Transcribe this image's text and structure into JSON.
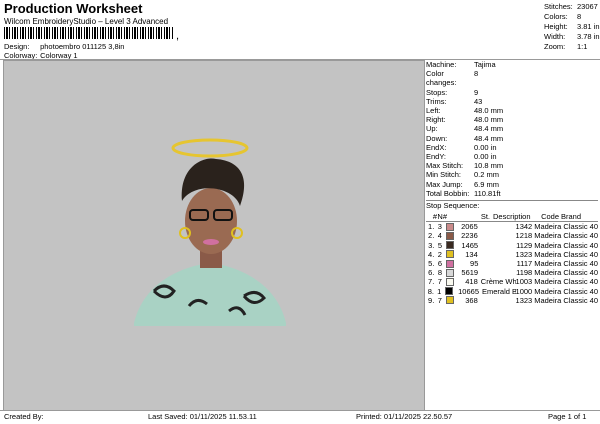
{
  "header": {
    "title": "Production Worksheet",
    "subtitle": "Wilcom EmbroideryStudio – Level 3 Advanced",
    "barcode_sep": ","
  },
  "meta": {
    "design_label": "Design:",
    "design_value": "photoembro 011125 3,8in",
    "colorway_label": "Colorway:",
    "colorway_value": "Colorway 1"
  },
  "summary": [
    {
      "label": "Stitches:",
      "value": "23067"
    },
    {
      "label": "Colors:",
      "value": "8"
    },
    {
      "label": "Height:",
      "value": "3.81 in"
    },
    {
      "label": "Width:",
      "value": "3.78 in"
    },
    {
      "label": "Zoom:",
      "value": "1:1"
    }
  ],
  "specs": [
    {
      "label": "Machine:",
      "value": "Tajima"
    },
    {
      "label": "Color changes:",
      "value": "8"
    },
    {
      "label": "Stops:",
      "value": "9"
    },
    {
      "label": "Trims:",
      "value": "43"
    },
    {
      "label": "Left:",
      "value": "48.0 mm"
    },
    {
      "label": "Right:",
      "value": "48.0 mm"
    },
    {
      "label": "Up:",
      "value": "48.4 mm"
    },
    {
      "label": "Down:",
      "value": "48.4 mm"
    },
    {
      "label": "EndX:",
      "value": "0.00 in"
    },
    {
      "label": "EndY:",
      "value": "0.00 in"
    },
    {
      "label": "Max Stitch:",
      "value": "10.8 mm"
    },
    {
      "label": "Min Stitch:",
      "value": "0.2 mm"
    },
    {
      "label": "Max Jump:",
      "value": "6.9 mm"
    },
    {
      "label": "Total Bobbin:",
      "value": "110.81ft"
    }
  ],
  "stop_sequence": {
    "title": "Stop Sequence:",
    "headers": {
      "n": "#",
      "no": "N#",
      "st": "St.",
      "desc": "Description",
      "code": "Code",
      "brand": "Brand"
    },
    "rows": [
      {
        "n": "1.",
        "no": "3",
        "color": "#c98a8a",
        "st": "2065",
        "desc": "",
        "code": "1342",
        "brand": "Madeira Classic 40"
      },
      {
        "n": "2.",
        "no": "4",
        "color": "#8a5a48",
        "st": "2236",
        "desc": "",
        "code": "1218",
        "brand": "Madeira Classic 40"
      },
      {
        "n": "3.",
        "no": "5",
        "color": "#3a2a20",
        "st": "1465",
        "desc": "",
        "code": "1129",
        "brand": "Madeira Classic 40"
      },
      {
        "n": "4.",
        "no": "2",
        "color": "#e0c020",
        "st": "134",
        "desc": "",
        "code": "1323",
        "brand": "Madeira Classic 40"
      },
      {
        "n": "5.",
        "no": "6",
        "color": "#d070a0",
        "st": "95",
        "desc": "",
        "code": "1117",
        "brand": "Madeira Classic 40"
      },
      {
        "n": "6.",
        "no": "8",
        "color": "#d8d8d8",
        "st": "5619",
        "desc": "",
        "code": "1198",
        "brand": "Madeira Classic 40"
      },
      {
        "n": "7.",
        "no": "7",
        "color": "#fafaf0",
        "st": "418",
        "desc": "Crème White",
        "code": "1003",
        "brand": "Madeira Classic 40"
      },
      {
        "n": "8.",
        "no": "1",
        "color": "#000000",
        "st": "10665",
        "desc": "Emerald Black",
        "code": "1000",
        "brand": "Madeira Classic 40"
      },
      {
        "n": "9.",
        "no": "7",
        "color": "#e0c020",
        "st": "368",
        "desc": "",
        "code": "1323",
        "brand": "Madeira Classic 40"
      }
    ]
  },
  "footer": {
    "created": "Created By:",
    "last_saved": "Last Saved: 01/11/2025 11.53.11",
    "printed": "Printed: 01/11/2025 22.50.57",
    "page": "Page 1 of 1"
  },
  "colors": {
    "canvas_bg": "#c3c3c3",
    "halo": "#e6c530",
    "sweater": "#a9d2c4"
  }
}
